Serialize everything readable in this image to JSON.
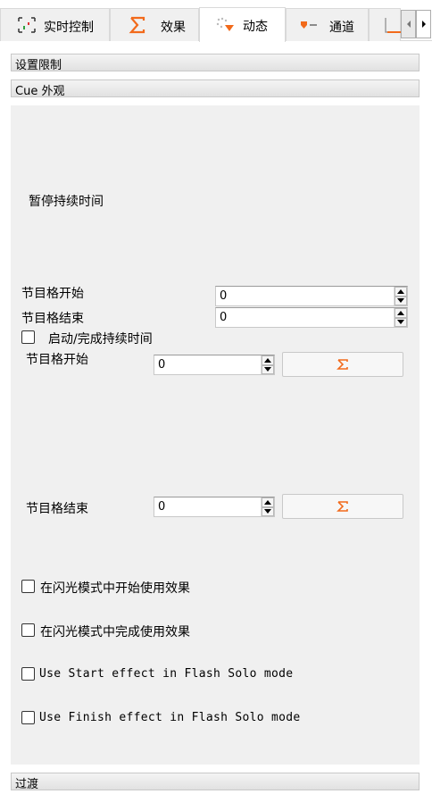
{
  "tabs": [
    {
      "label": "实时控制",
      "icon": "realtime-control-icon"
    },
    {
      "label": "效果",
      "icon": "sigma-icon"
    },
    {
      "label": "动态",
      "icon": "dynamics-icon",
      "active": true
    },
    {
      "label": "通道",
      "icon": "channel-icon"
    },
    {
      "label": "",
      "icon": "partial-tab-icon"
    }
  ],
  "sections": {
    "limits": "设置限制",
    "cue_appearance": "Cue 外观",
    "transition": "过渡"
  },
  "dynamics": {
    "pause_duration_label": "暂停持续时间",
    "beat_start_label": "节目格开始",
    "beat_start_value": "0",
    "beat_end_label": "节目格结束",
    "beat_end_value": "0",
    "start_finish_duration_label": "启动/完成持续时间",
    "start_finish_duration_checked": false,
    "beat_start2_label": "节目格开始",
    "beat_start2_value": "0",
    "beat_end2_label": "节目格结束",
    "beat_end2_value": "0",
    "start_effect_flash_label": "在闪光模式中开始使用效果",
    "finish_effect_flash_label": "在闪光模式中完成使用效果",
    "start_effect_flash_solo_label": "Use Start effect in Flash Solo mode",
    "finish_effect_flash_solo_label": "Use Finish effect in Flash Solo mode"
  },
  "colors": {
    "accent": "#f26a1b"
  }
}
